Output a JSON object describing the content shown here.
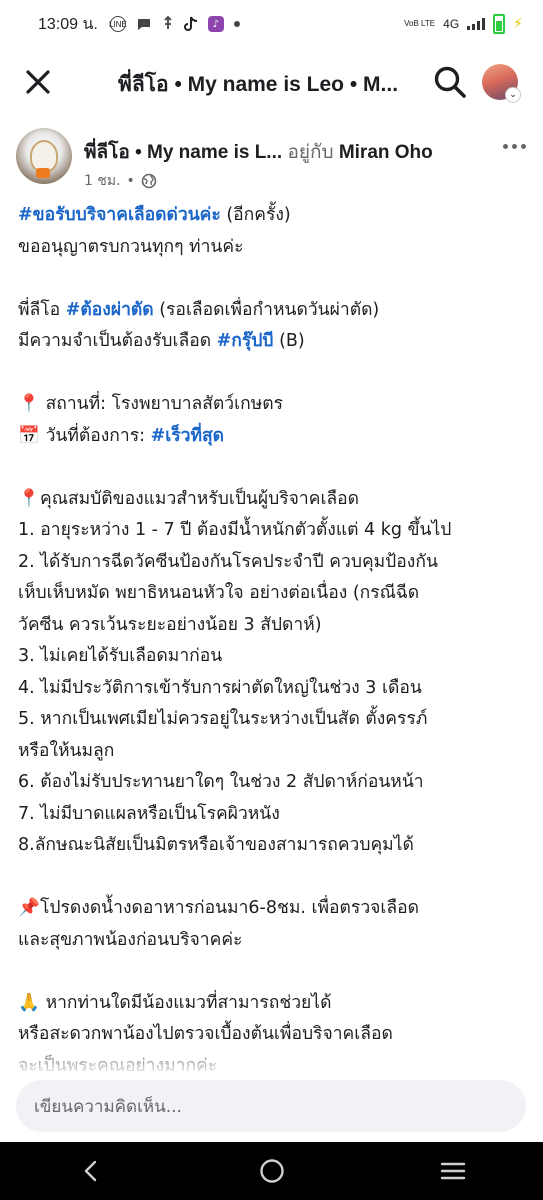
{
  "status_bar": {
    "time": "13:09 น.",
    "network": "4G",
    "volte": "VoB LTE",
    "icons": [
      "line-icon",
      "message-icon",
      "usb-icon",
      "tiktok-icon",
      "app-icon",
      "dot-icon",
      "signal-icon",
      "battery-charging-icon"
    ]
  },
  "header": {
    "title": "พี่ลีโอ • My name is Leo • M..."
  },
  "post": {
    "author": "พี่ลีโอ • My name is L...",
    "with_text": "อยู่กับ",
    "with_person": "Miran Oho",
    "time": "1 ชม.",
    "separator": "•",
    "lines": [
      {
        "tag": "#ขอรับบริจาคเลือดด่วนค่ะ",
        "text": " (อีกครั้ง)"
      },
      {
        "text": "ขออนุญาตรบกวนทุกๆ ท่านค่ะ"
      },
      {
        "gap": true
      },
      {
        "pre": "พี่ลีโอ ",
        "tag": "#ต้องผ่าตัด",
        "text": " (รอเลือดเพื่อกำหนดวันผ่าตัด)"
      },
      {
        "pre": "มีความจำเป็นต้องรับเลือด ",
        "tag": "#กรุ๊ปบี",
        "text": " (B)"
      },
      {
        "gap": true
      },
      {
        "emoji": "📍",
        "text": " สถานที่: โรงพยาบาลสัตว์เกษตร"
      },
      {
        "emoji": "📅",
        "pre": " วันที่ต้องการ: ",
        "tag": "#เร็วที่สุด"
      },
      {
        "gap": true
      },
      {
        "emoji": "📍",
        "text": "คุณสมบัติของแมวสำหรับเป็นผู้บริจาคเลือด"
      },
      {
        "text": "1. อายุระหว่าง 1 - 7 ปี ต้องมีน้ำหนักตัวตั้งแต่ 4 kg ขึ้นไป"
      },
      {
        "text": "2. ได้รับการฉีดวัคซีนป้องกันโรคประจำปี ควบคุมป้องกัน"
      },
      {
        "text": "เห็บเห็บหมัด พยาธิหนอนหัวใจ อย่างต่อเนื่อง (กรณีฉีด"
      },
      {
        "text": "วัคซีน ควรเว้นระยะอย่างน้อย 3 สัปดาห์)"
      },
      {
        "text": "3. ไม่เคยได้รับเลือดมาก่อน"
      },
      {
        "text": "4. ไม่มีประวัติการเข้ารับการผ่าตัดใหญ่ในช่วง 3 เดือน"
      },
      {
        "text": "5. หากเป็นเพศเมียไม่ควรอยู่ในระหว่างเป็นสัด ตั้งครรภ์"
      },
      {
        "text": "หรือให้นมลูก"
      },
      {
        "text": "6. ต้องไม่รับประทานยาใดๆ ในช่วง 2 สัปดาห์ก่อนหน้า"
      },
      {
        "text": "7. ไม่มีบาดแผลหรือเป็นโรคผิวหนัง"
      },
      {
        "text": "8.ลักษณะนิสัยเป็นมิตรหรือเจ้าของสามารถควบคุมได้"
      },
      {
        "gap": true
      },
      {
        "emoji": "📌",
        "text": "โปรดงดน้ำงดอาหารก่อนมา6-8ชม. เพื่อตรวจเลือด"
      },
      {
        "text": "และสุขภาพน้องก่อนบริจาคค่ะ"
      },
      {
        "gap": true
      },
      {
        "emoji": "🙏",
        "text": " หากท่านใดมีน้องแมวที่สามารถช่วยได้"
      },
      {
        "text": "หรือสะดวกพาน้องไปตรวจเบื้องต้นเพื่อบริจาคเลือด"
      },
      {
        "text": "จะเป็นพระคุณอย่างมากค่ะ"
      }
    ]
  },
  "comment": {
    "placeholder": "เขียนความคิดเห็น..."
  },
  "colors": {
    "hashtag": "#1b66c9",
    "muted": "#65676b",
    "input_bg": "#f0f2f5",
    "navbar": "#000000"
  }
}
